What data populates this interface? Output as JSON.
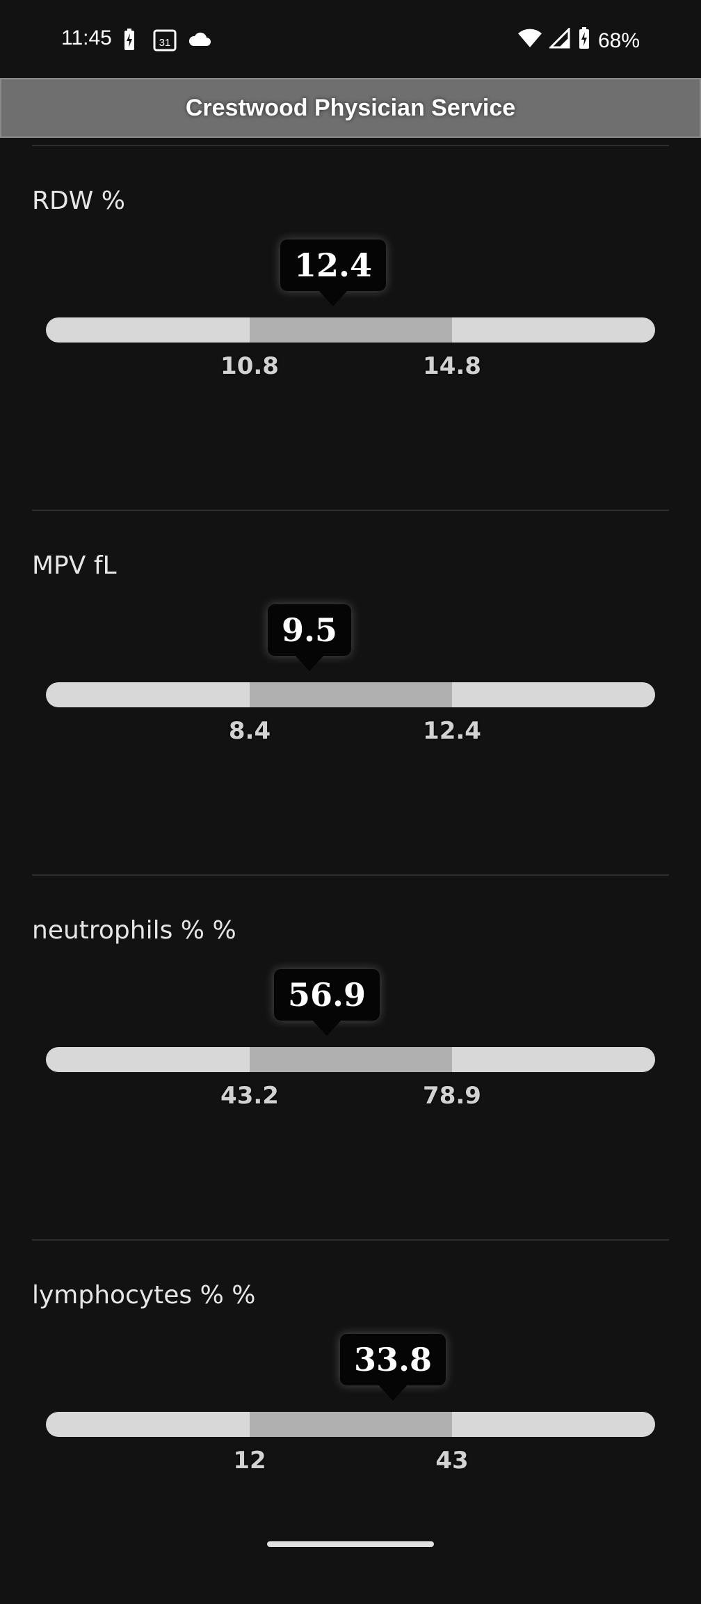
{
  "status_bar": {
    "time": "11:45",
    "battery": "68%",
    "icons": [
      "battery-charging-icon",
      "calendar-icon",
      "cloud-icon",
      "wifi-icon",
      "signal-icon",
      "battery-icon"
    ],
    "calendar_day": "31"
  },
  "header": {
    "title": "Crestwood Physician Service"
  },
  "results": [
    {
      "label": "RDW %",
      "value": "12.4",
      "low": "10.8",
      "high": "14.8"
    },
    {
      "label": "MPV fL",
      "value": "9.5",
      "low": "8.4",
      "high": "12.4"
    },
    {
      "label": "neutrophils % %",
      "value": "56.9",
      "low": "43.2",
      "high": "78.9"
    },
    {
      "label": "lymphocytes % %",
      "value": "33.8",
      "low": "12",
      "high": "43"
    }
  ]
}
